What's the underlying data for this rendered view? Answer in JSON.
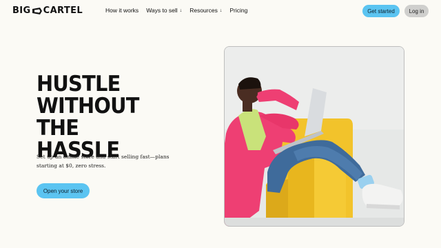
{
  "brand": {
    "left": "BIG",
    "right": "CARTEL"
  },
  "nav": {
    "items": [
      {
        "label": "How it works",
        "arrow": ""
      },
      {
        "label": "Ways to sell",
        "arrow": "↓"
      },
      {
        "label": "Resources",
        "arrow": "↓"
      },
      {
        "label": "Pricing",
        "arrow": ""
      }
    ],
    "get_started": "Get started",
    "login": "Log in"
  },
  "hero": {
    "title_lines": [
      "HUSTLE",
      "WITHOUT THE",
      "HASSLE"
    ],
    "subtitle": "Set up an online store and start selling fast—plans starting at $0, zero stress.",
    "cta": "Open your store"
  },
  "colors": {
    "accent": "#5bc4f1",
    "background": "#fbfaf5",
    "secondary_button": "#cfcfcd"
  },
  "icons": {
    "logo_mark": "megaphone-icon",
    "chevron": "arrow-down-icon"
  }
}
